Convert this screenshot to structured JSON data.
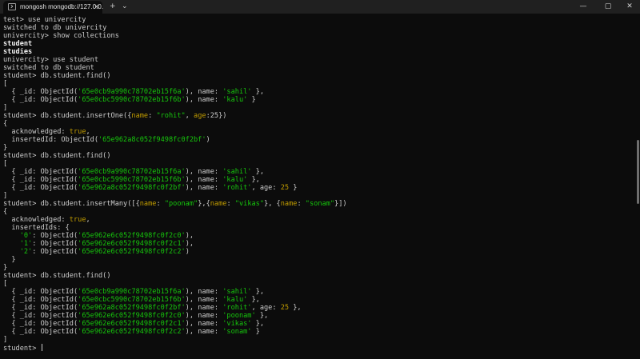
{
  "window": {
    "tab_title": "mongosh mongodb://127.0.0.",
    "tab_close": "×",
    "new_tab": "+",
    "dropdown": "⌄",
    "minimize": "—",
    "maximize": "▢",
    "close": "✕"
  },
  "terminal": {
    "lines": [
      [
        {
          "t": "test> use univercity"
        }
      ],
      [
        {
          "t": "switched to db univercity"
        }
      ],
      [
        {
          "t": "univercity> show collections"
        }
      ],
      [
        {
          "t": "student",
          "c": "b"
        }
      ],
      [
        {
          "t": "studies",
          "c": "b"
        }
      ],
      [
        {
          "t": "univercity> use student"
        }
      ],
      [
        {
          "t": "switched to db student"
        }
      ],
      [
        {
          "t": "student> db.student.find()"
        }
      ],
      [
        {
          "t": "["
        }
      ],
      [
        {
          "t": "  { _id: ObjectId("
        },
        {
          "t": "'65e0cb9a990c78702eb15f6a'",
          "c": "g"
        },
        {
          "t": "), name: "
        },
        {
          "t": "'sahil'",
          "c": "g"
        },
        {
          "t": " },"
        }
      ],
      [
        {
          "t": "  { _id: ObjectId("
        },
        {
          "t": "'65e0cbc5990c78702eb15f6b'",
          "c": "g"
        },
        {
          "t": "), name: "
        },
        {
          "t": "'kalu'",
          "c": "g"
        },
        {
          "t": " }"
        }
      ],
      [
        {
          "t": "]"
        }
      ],
      [
        {
          "t": "student> db.student.insertOne({"
        },
        {
          "t": "name",
          "c": "y"
        },
        {
          "t": ": "
        },
        {
          "t": "\"rohit\"",
          "c": "g"
        },
        {
          "t": ", "
        },
        {
          "t": "age",
          "c": "y"
        },
        {
          "t": ":25})"
        }
      ],
      [
        {
          "t": "{"
        }
      ],
      [
        {
          "t": "  acknowledged: "
        },
        {
          "t": "true",
          "c": "y"
        },
        {
          "t": ","
        }
      ],
      [
        {
          "t": "  insertedId: ObjectId("
        },
        {
          "t": "'65e962a8c052f9498fc0f2bf'",
          "c": "g"
        },
        {
          "t": ")"
        }
      ],
      [
        {
          "t": "}"
        }
      ],
      [
        {
          "t": "student> db.student.find()"
        }
      ],
      [
        {
          "t": "["
        }
      ],
      [
        {
          "t": "  { _id: ObjectId("
        },
        {
          "t": "'65e0cb9a990c78702eb15f6a'",
          "c": "g"
        },
        {
          "t": "), name: "
        },
        {
          "t": "'sahil'",
          "c": "g"
        },
        {
          "t": " },"
        }
      ],
      [
        {
          "t": "  { _id: ObjectId("
        },
        {
          "t": "'65e0cbc5990c78702eb15f6b'",
          "c": "g"
        },
        {
          "t": "), name: "
        },
        {
          "t": "'kalu'",
          "c": "g"
        },
        {
          "t": " },"
        }
      ],
      [
        {
          "t": "  { _id: ObjectId("
        },
        {
          "t": "'65e962a8c052f9498fc0f2bf'",
          "c": "g"
        },
        {
          "t": "), name: "
        },
        {
          "t": "'rohit'",
          "c": "g"
        },
        {
          "t": ", age: "
        },
        {
          "t": "25",
          "c": "y"
        },
        {
          "t": " }"
        }
      ],
      [
        {
          "t": "]"
        }
      ],
      [
        {
          "t": "student> db.student.insertMany([{"
        },
        {
          "t": "name",
          "c": "y"
        },
        {
          "t": ": "
        },
        {
          "t": "\"poonam\"",
          "c": "g"
        },
        {
          "t": "},{"
        },
        {
          "t": "name",
          "c": "y"
        },
        {
          "t": ": "
        },
        {
          "t": "\"vikas\"",
          "c": "g"
        },
        {
          "t": "}, {"
        },
        {
          "t": "name",
          "c": "y"
        },
        {
          "t": ": "
        },
        {
          "t": "\"sonam\"",
          "c": "g"
        },
        {
          "t": "}])"
        }
      ],
      [
        {
          "t": "{"
        }
      ],
      [
        {
          "t": "  acknowledged: "
        },
        {
          "t": "true",
          "c": "y"
        },
        {
          "t": ","
        }
      ],
      [
        {
          "t": "  insertedIds: {"
        }
      ],
      [
        {
          "t": "    "
        },
        {
          "t": "'0'",
          "c": "g"
        },
        {
          "t": ": ObjectId("
        },
        {
          "t": "'65e962e6c052f9498fc0f2c0'",
          "c": "g"
        },
        {
          "t": "),"
        }
      ],
      [
        {
          "t": "    "
        },
        {
          "t": "'1'",
          "c": "g"
        },
        {
          "t": ": ObjectId("
        },
        {
          "t": "'65e962e6c052f9498fc0f2c1'",
          "c": "g"
        },
        {
          "t": "),"
        }
      ],
      [
        {
          "t": "    "
        },
        {
          "t": "'2'",
          "c": "g"
        },
        {
          "t": ": ObjectId("
        },
        {
          "t": "'65e962e6c052f9498fc0f2c2'",
          "c": "g"
        },
        {
          "t": ")"
        }
      ],
      [
        {
          "t": "  }"
        }
      ],
      [
        {
          "t": "}"
        }
      ],
      [
        {
          "t": "student> db.student.find()"
        }
      ],
      [
        {
          "t": "["
        }
      ],
      [
        {
          "t": "  { _id: ObjectId("
        },
        {
          "t": "'65e0cb9a990c78702eb15f6a'",
          "c": "g"
        },
        {
          "t": "), name: "
        },
        {
          "t": "'sahil'",
          "c": "g"
        },
        {
          "t": " },"
        }
      ],
      [
        {
          "t": "  { _id: ObjectId("
        },
        {
          "t": "'65e0cbc5990c78702eb15f6b'",
          "c": "g"
        },
        {
          "t": "), name: "
        },
        {
          "t": "'kalu'",
          "c": "g"
        },
        {
          "t": " },"
        }
      ],
      [
        {
          "t": "  { _id: ObjectId("
        },
        {
          "t": "'65e962a8c052f9498fc0f2bf'",
          "c": "g"
        },
        {
          "t": "), name: "
        },
        {
          "t": "'rohit'",
          "c": "g"
        },
        {
          "t": ", age: "
        },
        {
          "t": "25",
          "c": "y"
        },
        {
          "t": " },"
        }
      ],
      [
        {
          "t": "  { _id: ObjectId("
        },
        {
          "t": "'65e962e6c052f9498fc0f2c0'",
          "c": "g"
        },
        {
          "t": "), name: "
        },
        {
          "t": "'poonam'",
          "c": "g"
        },
        {
          "t": " },"
        }
      ],
      [
        {
          "t": "  { _id: ObjectId("
        },
        {
          "t": "'65e962e6c052f9498fc0f2c1'",
          "c": "g"
        },
        {
          "t": "), name: "
        },
        {
          "t": "'vikas'",
          "c": "g"
        },
        {
          "t": " },"
        }
      ],
      [
        {
          "t": "  { _id: ObjectId("
        },
        {
          "t": "'65e962e6c052f9498fc0f2c2'",
          "c": "g"
        },
        {
          "t": "), name: "
        },
        {
          "t": "'sonam'",
          "c": "g"
        },
        {
          "t": " }"
        }
      ],
      [
        {
          "t": "]"
        }
      ],
      [
        {
          "t": "student> "
        }
      ]
    ]
  },
  "colors": {
    "background": "#0c0c0c",
    "titlebar": "#202020",
    "text": "#cccccc",
    "string_green": "#16c60c",
    "keyword_yellow": "#c19c00"
  },
  "icons": {
    "tab": "terminal-icon",
    "close": "close-icon",
    "new_tab": "plus-icon",
    "dropdown": "chevron-down-icon"
  }
}
